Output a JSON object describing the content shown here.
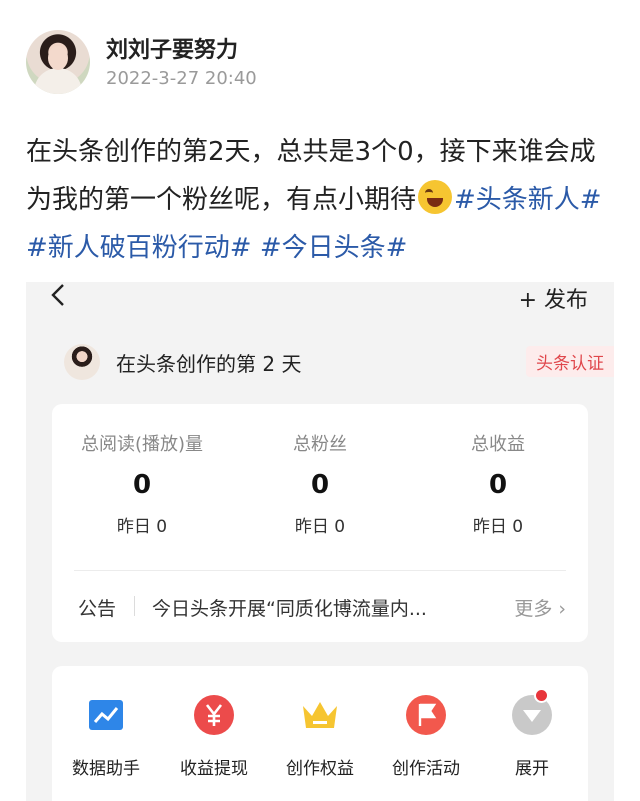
{
  "post": {
    "author": "刘刘子要努力",
    "time": "2022-3-27 20:40",
    "text_before": "在头条创作的第2天，总共是3个0，接下来谁会成为我的第一个粉丝呢，有点小期待",
    "emoji": "laughing-emoji",
    "hashtags": [
      "#头条新人#",
      "#新人破百粉行动#",
      "#今日头条#"
    ]
  },
  "app": {
    "back_icon": "chevron-left-icon",
    "publish_label": "+ 发布",
    "day_title": "在头条创作的第 2 天",
    "cert_label": "头条认证",
    "stats": [
      {
        "label": "总阅读(播放)量",
        "value": "0",
        "sub": "昨日 0"
      },
      {
        "label": "总粉丝",
        "value": "0",
        "sub": "昨日 0"
      },
      {
        "label": "总收益",
        "value": "0",
        "sub": "昨日 0"
      }
    ],
    "notice": {
      "label": "公告",
      "text": "今日头条开展“同质化博流量内...",
      "more": "更多 ›"
    },
    "tools": [
      {
        "label": "数据助手",
        "icon": "chart-icon"
      },
      {
        "label": "收益提现",
        "icon": "yen-icon"
      },
      {
        "label": "创作权益",
        "icon": "crown-icon"
      },
      {
        "label": "创作活动",
        "icon": "flag-icon"
      },
      {
        "label": "展开",
        "icon": "expand-icon"
      }
    ]
  },
  "colors": {
    "hashtag": "#2b5aa8",
    "cert": "#e0474c",
    "accent_red": "#ec4b4b",
    "accent_blue": "#2e86e8",
    "accent_yellow": "#f6c531"
  }
}
